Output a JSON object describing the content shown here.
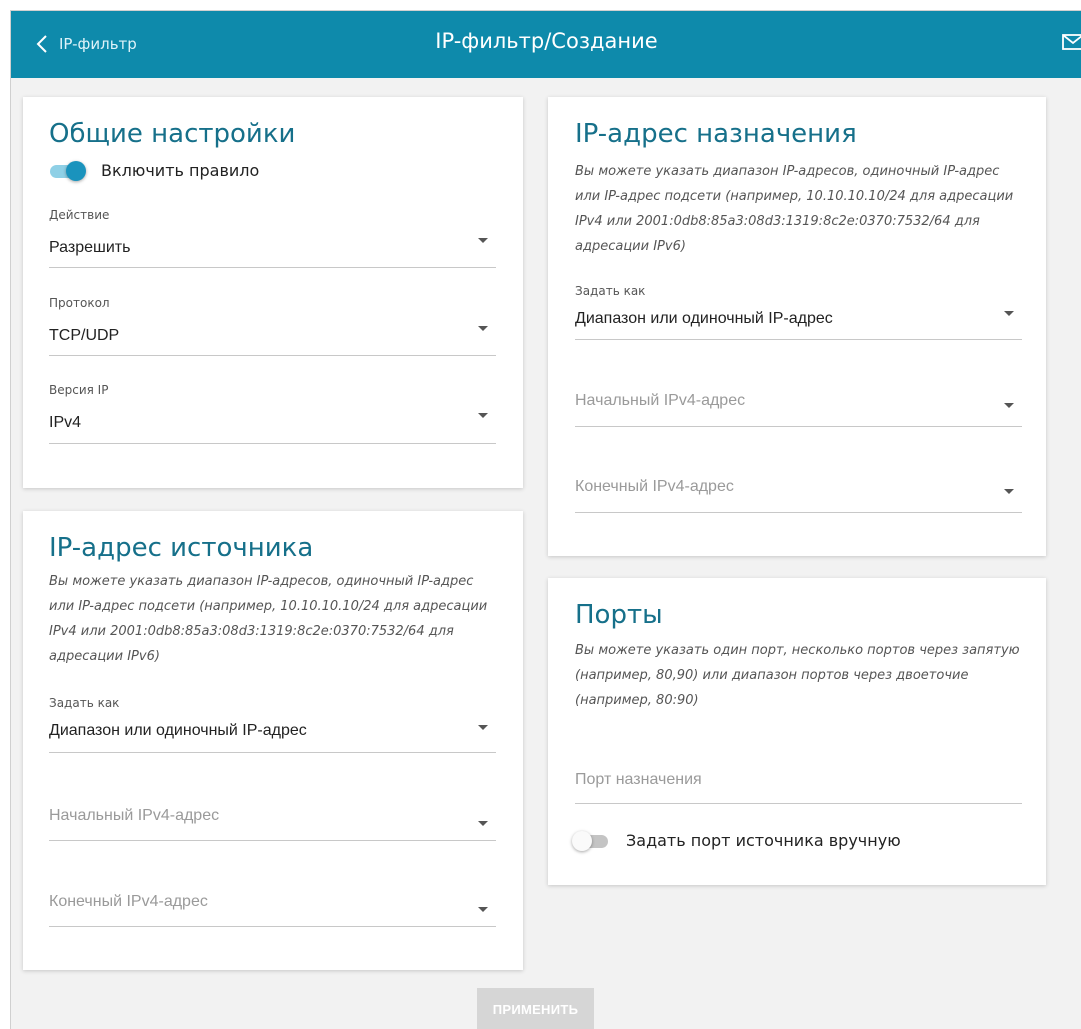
{
  "header": {
    "back_label": "IP-фильтр",
    "title": "IP-фильтр/Создание",
    "color": "#0e8aab"
  },
  "general": {
    "title": "Общие настройки",
    "enable_rule_label": "Включить правило",
    "enable_rule_on": true,
    "action": {
      "label": "Действие",
      "value": "Разрешить"
    },
    "protocol": {
      "label": "Протокол",
      "value": "TCP/UDP"
    },
    "ip_version": {
      "label": "Версия IP",
      "value": "IPv4"
    }
  },
  "source": {
    "title": "IP-адрес источника",
    "hint_lines": [
      "Вы можете указать диапазон IP-адресов, одиночный IP-адрес",
      "или IP-адрес подсети (например, 10.10.10.10/24 для адресации",
      "IPv4 или 2001:0db8:85a3:08d3:1319:8c2e:0370:7532/64 для",
      "адресации IPv6)"
    ],
    "set_as": {
      "label": "Задать как",
      "value": "Диапазон или одиночный IP-адрес"
    },
    "start_placeholder": "Начальный IPv4-адрес",
    "end_placeholder": "Конечный IPv4-адрес"
  },
  "destination": {
    "title": "IP-адрес назначения",
    "hint_lines": [
      "Вы можете указать диапазон IP-адресов, одиночный IP-адрес",
      "или IP-адрес подсети (например, 10.10.10.10/24 для адресации",
      "IPv4 или 2001:0db8:85a3:08d3:1319:8c2e:0370:7532/64 для",
      "адресации IPv6)"
    ],
    "set_as": {
      "label": "Задать как",
      "value": "Диапазон или одиночный IP-адрес"
    },
    "start_placeholder": "Начальный IPv4-адрес",
    "end_placeholder": "Конечный IPv4-адрес"
  },
  "ports": {
    "title": "Порты",
    "hint_lines": [
      "Вы можете указать один порт, несколько портов через запятую",
      "(например, 80,90) или диапазон портов через двоеточие",
      "(например, 80:90)"
    ],
    "dest_port_placeholder": "Порт назначения",
    "manual_source_label": "Задать порт источника вручную",
    "manual_source_on": false
  },
  "apply_label": "ПРИМЕНИТЬ",
  "colors": {
    "accent": "#1a93bd",
    "title": "#16708a",
    "apply_disabled": "#d6d6d6"
  }
}
